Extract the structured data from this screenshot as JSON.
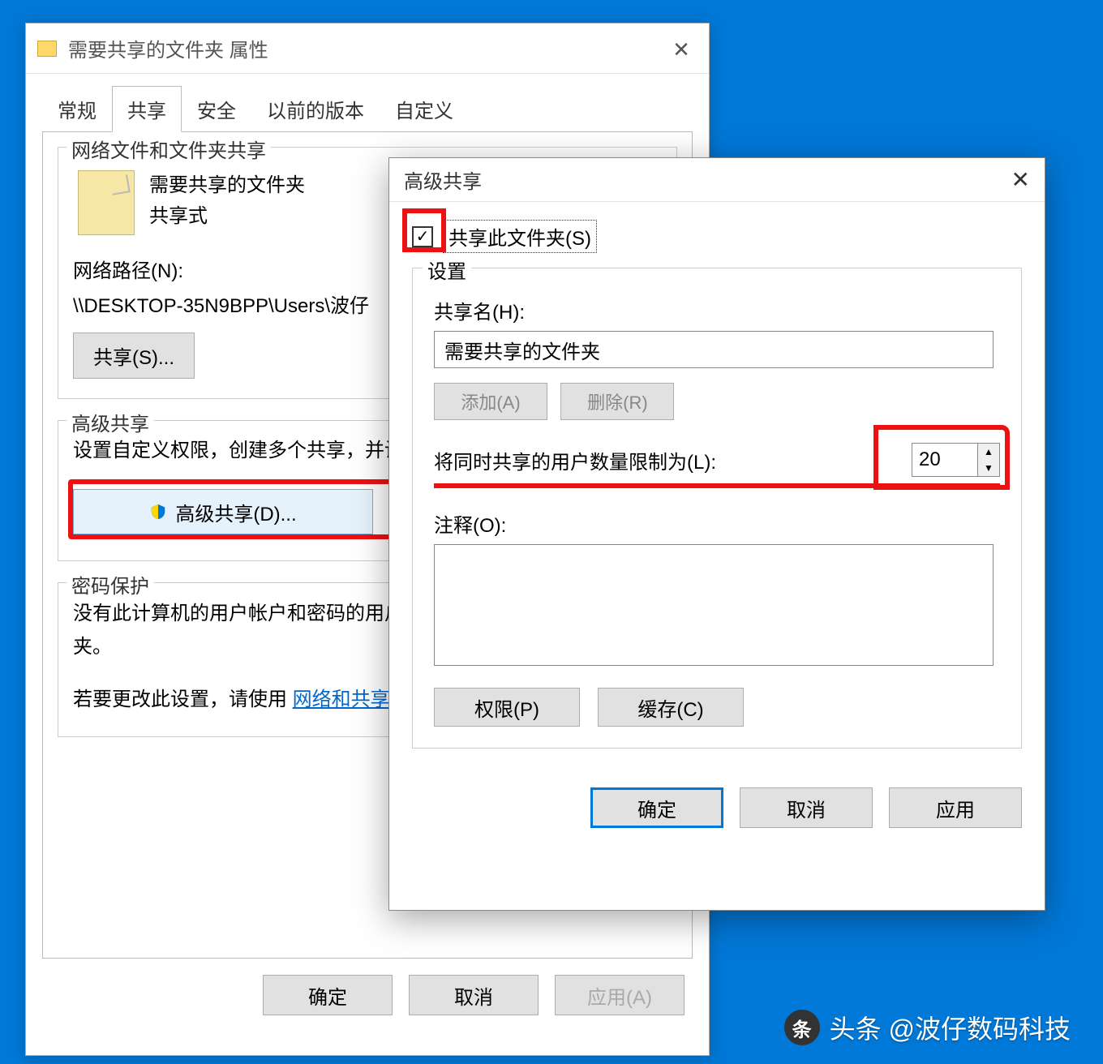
{
  "props": {
    "title": "需要共享的文件夹 属性",
    "tabs": [
      "常规",
      "共享",
      "安全",
      "以前的版本",
      "自定义"
    ],
    "active_tab": 1,
    "net_section": {
      "legend": "网络文件和文件夹共享",
      "folder_name": "需要共享的文件夹",
      "share_state": "共享式",
      "path_label": "网络路径(N):",
      "path_value": "\\\\DESKTOP-35N9BPP\\Users\\波仔",
      "share_btn": "共享(S)..."
    },
    "adv_section": {
      "legend": "高级共享",
      "desc": "设置自定义权限，创建多个共享，并设置其他高级共享选项。",
      "button": "高级共享(D)..."
    },
    "pw_section": {
      "legend": "密码保护",
      "line1": "没有此计算机的用户帐户和密码的用户可以访问与所有人共享的文件夹。",
      "line2_pre": "若要更改此设置，请使用",
      "line2_link": "网络和共享中心"
    },
    "buttons": {
      "ok": "确定",
      "cancel": "取消",
      "apply": "应用(A)"
    }
  },
  "adv": {
    "title": "高级共享",
    "checkbox_label": "共享此文件夹(S)",
    "checked": true,
    "settings_legend": "设置",
    "share_name_label": "共享名(H):",
    "share_name_value": "需要共享的文件夹",
    "add_btn": "添加(A)",
    "remove_btn": "删除(R)",
    "limit_label": "将同时共享的用户数量限制为(L):",
    "limit_value": "20",
    "comment_label": "注释(O):",
    "comment_value": "",
    "perm_btn": "权限(P)",
    "cache_btn": "缓存(C)",
    "ok": "确定",
    "cancel": "取消",
    "apply": "应用"
  },
  "watermark": {
    "logo": "条",
    "prefix": "头条",
    "text": "@波仔数码科技"
  }
}
